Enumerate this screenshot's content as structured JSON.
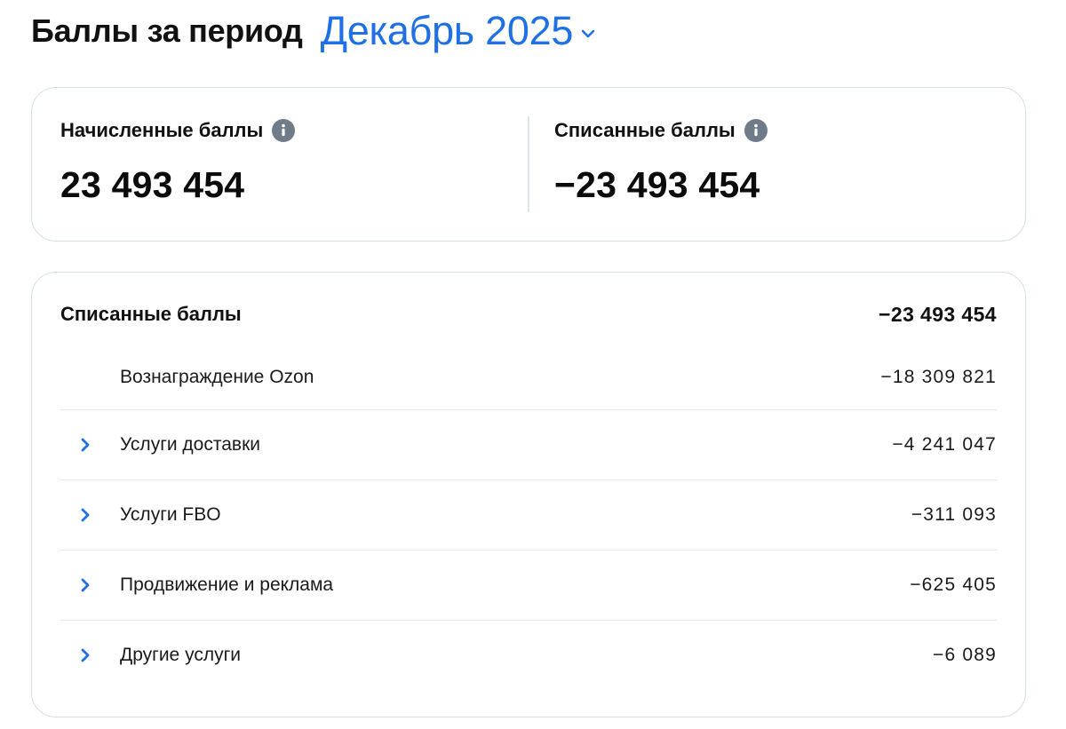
{
  "header": {
    "title": "Баллы за период",
    "period": "Декабрь 2025"
  },
  "summary": {
    "accrued": {
      "label": "Начисленные баллы",
      "value": "23 493 454"
    },
    "written_off": {
      "label": "Списанные баллы",
      "value": "−23 493 454"
    }
  },
  "details": {
    "title": "Списанные баллы",
    "total": "−23 493 454",
    "rows": [
      {
        "label": "Вознаграждение Ozon",
        "value": "−18 309 821",
        "expandable": false
      },
      {
        "label": "Услуги доставки",
        "value": "−4 241 047",
        "expandable": true
      },
      {
        "label": "Услуги FBO",
        "value": "−311 093",
        "expandable": true
      },
      {
        "label": "Продвижение и реклама",
        "value": "−625 405",
        "expandable": true
      },
      {
        "label": "Другие услуги",
        "value": "−6 089",
        "expandable": true
      }
    ]
  },
  "colors": {
    "accent": "#1f6fe5",
    "info_icon": "#6f7b88",
    "border": "#d6dee8"
  },
  "icons": {
    "period_dropdown": "chevron-down-icon",
    "info": "info-icon",
    "row_expand": "chevron-right-icon"
  }
}
